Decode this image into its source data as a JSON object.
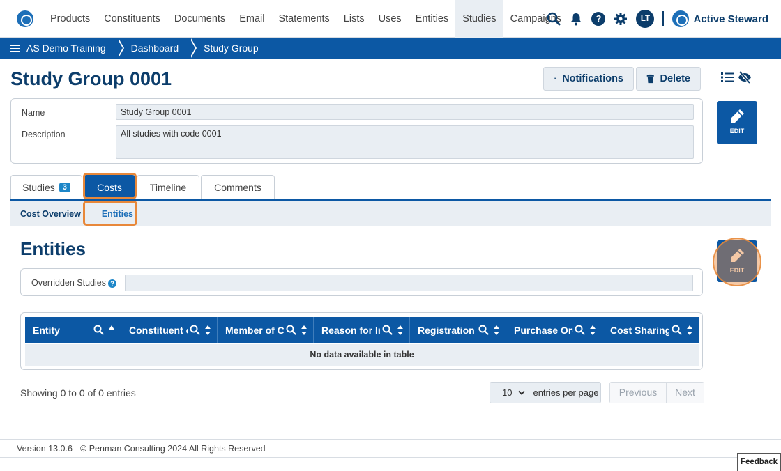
{
  "nav": {
    "items": [
      "Products",
      "Constituents",
      "Documents",
      "Email",
      "Statements",
      "Lists",
      "Uses",
      "Entities",
      "Studies",
      "Campaigns"
    ],
    "active": "Studies",
    "user_initials": "LT",
    "brand": "Active Steward",
    "help_glyph": "?"
  },
  "breadcrumb": [
    "AS Demo Training",
    "Dashboard",
    "Study Group"
  ],
  "page": {
    "title": "Study Group 0001",
    "notifications_label": "Notifications",
    "delete_label": "Delete",
    "edit_label": "EDIT"
  },
  "details": {
    "name_label": "Name",
    "name_value": "Study Group 0001",
    "description_label": "Description",
    "description_value": "All studies with code 0001"
  },
  "tabs": {
    "studies_label": "Studies",
    "studies_count": "3",
    "costs_label": "Costs",
    "timeline_label": "Timeline",
    "comments_label": "Comments"
  },
  "subtabs": {
    "cost_overview": "Cost Overview",
    "entities": "Entities"
  },
  "entities": {
    "title": "Entities",
    "overridden_label": "Overridden Studies",
    "overridden_value": "",
    "columns": [
      "Entity",
      "Constituent of",
      "Member of Ca",
      "Reason for In",
      "Registration I",
      "Purchase Ord",
      "Cost Sharing I"
    ],
    "empty_message": "No data available in table",
    "showing": "Showing 0 to 0 of 0 entries",
    "per_page_value": "10",
    "per_page_label": "entries per page",
    "previous": "Previous",
    "next": "Next"
  },
  "footer": {
    "version": "Version 13.0.6 - © Penman Consulting 2024 All Rights Reserved",
    "feedback": "Feedback"
  },
  "colors": {
    "primary": "#0c58a4",
    "dark": "#0c3d6b",
    "highlight": "#e8883a"
  },
  "icons": [
    "search-icon",
    "bell-icon",
    "help-icon",
    "gear-icon",
    "bell-slash-icon",
    "trash-icon",
    "list-icon",
    "eye-slash-icon",
    "pencil-icon",
    "sort-icon",
    "chevron-down-icon",
    "hamburger-icon"
  ]
}
